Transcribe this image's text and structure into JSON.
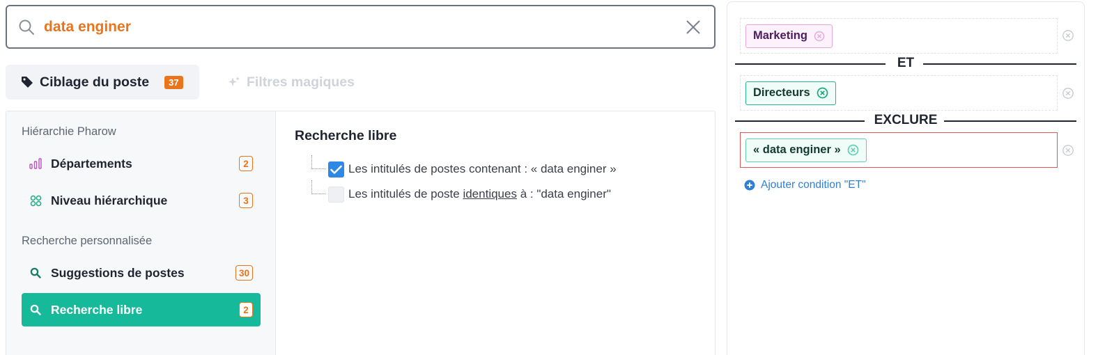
{
  "search": {
    "value": "data enginer",
    "icon": "search-icon",
    "clear_icon": "close-icon"
  },
  "tabs": {
    "ciblage": {
      "label": "Ciblage du poste",
      "badge": "37",
      "icon": "tag-icon"
    },
    "magic": {
      "label": "Filtres magiques",
      "icon": "sparkle-icon"
    }
  },
  "sidebar": {
    "section1": "Hiérarchie Pharow",
    "section2": "Recherche personnalisée",
    "items": [
      {
        "label": "Départements",
        "count": "2",
        "icon": "bar-chart-icon"
      },
      {
        "label": "Niveau hiérarchique",
        "count": "3",
        "icon": "grid-icon"
      },
      {
        "label": "Suggestions de postes",
        "count": "30",
        "icon": "search-icon"
      },
      {
        "label": "Recherche libre",
        "count": "2",
        "icon": "search-icon",
        "active": true
      }
    ]
  },
  "content": {
    "title": "Recherche libre",
    "options": [
      {
        "text_prefix": "Les intitulés de postes contenant : « data enginer »",
        "checked": true
      },
      {
        "text_prefix": "Les intitulés de poste ",
        "text_underlined": "identiques",
        "text_suffix": " à : \"data enginer\"",
        "checked": false
      }
    ]
  },
  "conditions": {
    "row1_tag": "Marketing",
    "sep_and": "ET",
    "row2_tag": "Directeurs",
    "sep_exclude": "EXCLURE",
    "row3_tag": "« data enginer »",
    "add_label": "Ajouter condition \"ET\""
  },
  "colors": {
    "accent_orange": "#e8741c",
    "active_green": "#16b99a",
    "link_blue": "#2f7fd6",
    "exclude_red": "#e05555",
    "tag_purple_border": "#e9a8dc",
    "tag_green_border": "#28b48c"
  }
}
